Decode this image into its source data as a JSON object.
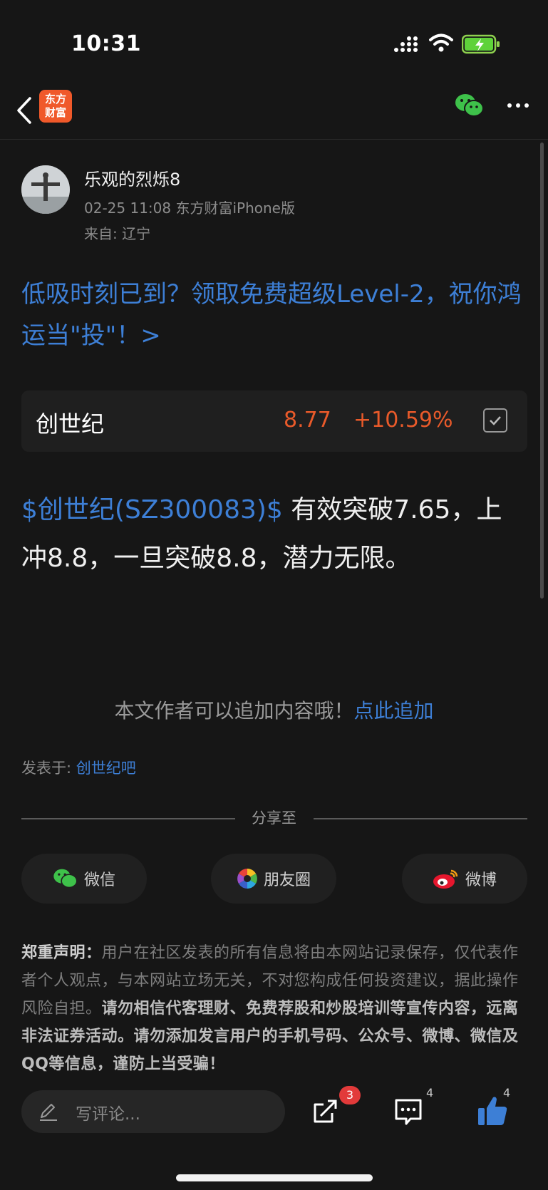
{
  "status_bar": {
    "time": "10:31"
  },
  "nav": {
    "logo_text_line1": "东方",
    "logo_text_line2": "财富"
  },
  "author": {
    "name": "乐观的烈烁8",
    "meta": "02-25 11:08  东方财富iPhone版",
    "location": "来自: 辽宁"
  },
  "promo": {
    "text": "低吸时刻已到？领取免费超级Level-2，祝你鸿运当\"投\"！>"
  },
  "stock": {
    "name": "创世纪",
    "price": "8.77",
    "change": "+10.59%"
  },
  "content": {
    "link": "$创世纪(SZ300083)$",
    "body": " 有效突破7.65，上冲8.8，一旦突破8.8，潜力无限。"
  },
  "add_content": {
    "text": "本文作者可以追加内容哦！",
    "link": "点此追加"
  },
  "posted_in": {
    "label": "发表于: ",
    "bar": "创世纪吧"
  },
  "share": {
    "label": "分享至",
    "buttons": [
      {
        "label": "微信",
        "icon": "wechat-icon"
      },
      {
        "label": "朋友圈",
        "icon": "moments-icon"
      },
      {
        "label": "微博",
        "icon": "weibo-icon"
      }
    ]
  },
  "disclaimer": {
    "title": "郑重声明：",
    "text1": "用户在社区发表的所有信息将由本网站记录保存，仅代表作者个人观点，与本网站立场无关，不对您构成任何投资建议，据此操作风险自担。",
    "text2": "请勿相信代客理财、免费荐股和炒股培训等宣传内容，远离非法证券活动。请勿添加发言用户的手机号码、公众号、微博、微信及QQ等信息，谨防上当受骗！"
  },
  "bottom_bar": {
    "comment_placeholder": "写评论...",
    "share_badge": "3",
    "comment_count": "4",
    "like_count": "4"
  },
  "colors": {
    "accent": "#3d7fd6",
    "up": "#e95a2a",
    "brand": "#f0592a"
  }
}
